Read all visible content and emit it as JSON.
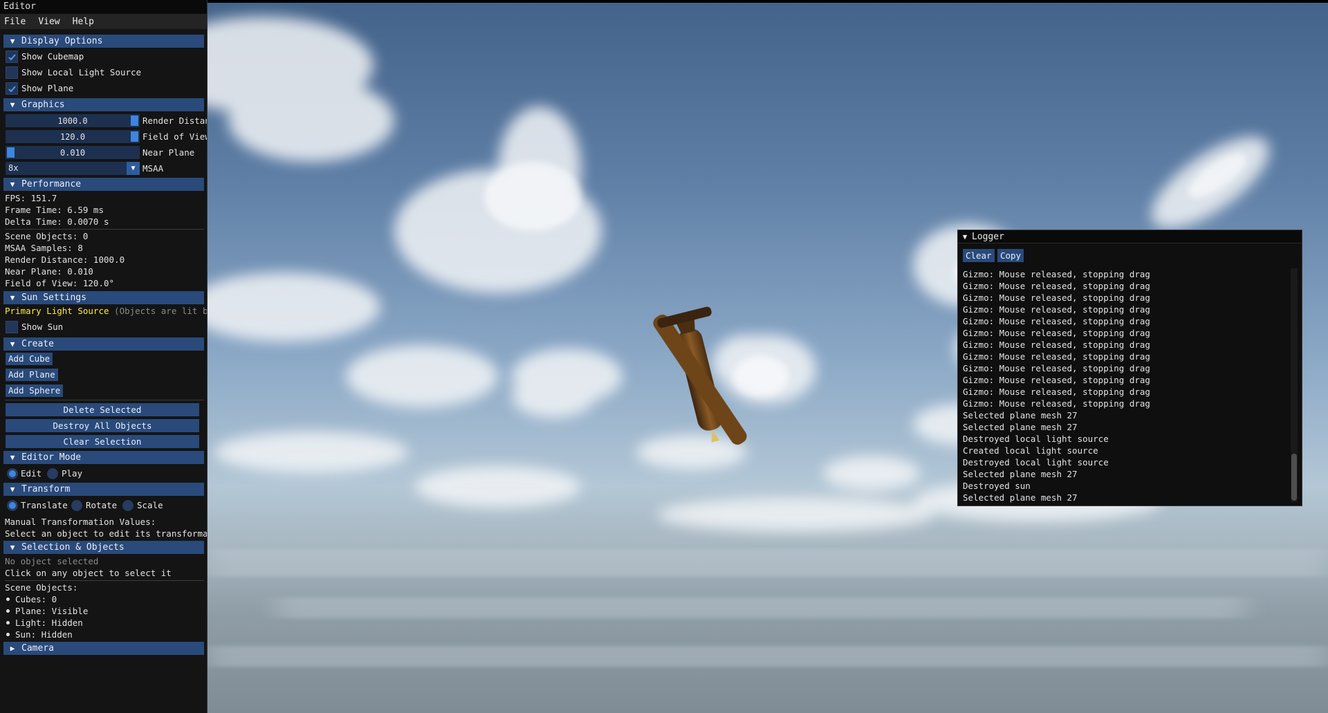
{
  "window_title": "Editor",
  "menu": [
    "File",
    "View",
    "Help"
  ],
  "display_options": {
    "header": "Display Options",
    "show_cubemap": "Show Cubemap",
    "show_local_light": "Show Local Light Source",
    "show_plane": "Show Plane",
    "checked": {
      "cubemap": true,
      "local_light": false,
      "plane": true
    }
  },
  "graphics": {
    "header": "Graphics",
    "render_distance": {
      "value": "1000.0",
      "label": "Render Distance",
      "fraction": 1.0
    },
    "field_of_view": {
      "value": "120.0",
      "label": "Field of View",
      "fraction": 1.0
    },
    "near_plane": {
      "value": "0.010",
      "label": "Near Plane",
      "fraction": 0.0
    },
    "msaa": {
      "value": "8x",
      "label": "MSAA"
    }
  },
  "performance": {
    "header": "Performance",
    "fps": "FPS: 151.7",
    "frame_time": "Frame Time: 6.59 ms",
    "delta_time": "Delta Time: 0.0070 s",
    "scene_objects": "Scene Objects: 0",
    "msaa_samples": "MSAA Samples: 8",
    "render_distance": "Render Distance: 1000.0",
    "near_plane": "Near Plane: 0.010",
    "field_of_view": "Field of View: 120.0°"
  },
  "sun_settings": {
    "header": "Sun Settings",
    "primary": "Primary Light Source",
    "primary_note": "(Objects are lit by t",
    "show_sun": "Show Sun",
    "checked": false
  },
  "create": {
    "header": "Create",
    "add_cube": "Add Cube",
    "add_plane": "Add Plane",
    "add_sphere": "Add Sphere",
    "delete_selected": "Delete Selected",
    "destroy_all": "Destroy All Objects",
    "clear_selection": "Clear Selection"
  },
  "editor_mode": {
    "header": "Editor Mode",
    "edit": "Edit",
    "play": "Play",
    "selected": "Edit"
  },
  "transform": {
    "header": "Transform",
    "translate": "Translate",
    "rotate": "Rotate",
    "scale": "Scale",
    "selected": "Translate",
    "manual_label": "Manual Transformation Values:",
    "manual_hint": "Select an object to edit its transformation"
  },
  "selection": {
    "header": "Selection & Objects",
    "none_selected": "No object selected",
    "click_hint": "Click on any object to select it",
    "scene_objects_label": "Scene Objects:",
    "items": [
      "Cubes: 0",
      "Plane: Visible",
      "Light: Hidden",
      "Sun: Hidden"
    ]
  },
  "camera": {
    "header": "Camera"
  },
  "logger": {
    "title": "Logger",
    "clear": "Clear",
    "copy": "Copy",
    "lines": [
      "Gizmo: Mouse released, stopping drag",
      "Gizmo: Mouse released, stopping drag",
      "Gizmo: Mouse released, stopping drag",
      "Gizmo: Mouse released, stopping drag",
      "Gizmo: Mouse released, stopping drag",
      "Gizmo: Mouse released, stopping drag",
      "Gizmo: Mouse released, stopping drag",
      "Gizmo: Mouse released, stopping drag",
      "Gizmo: Mouse released, stopping drag",
      "Gizmo: Mouse released, stopping drag",
      "Gizmo: Mouse released, stopping drag",
      "Gizmo: Mouse released, stopping drag",
      "Selected plane mesh 27",
      "Selected plane mesh 27",
      "Destroyed local light source",
      "Created local light source",
      "Destroyed local light source",
      "Selected plane mesh 27",
      "Destroyed sun",
      "Selected plane mesh 27"
    ]
  },
  "colors": {
    "header": "#294a7a",
    "accent": "#3d85e0",
    "panel": "#141414",
    "yellow": "#ffee3a"
  }
}
